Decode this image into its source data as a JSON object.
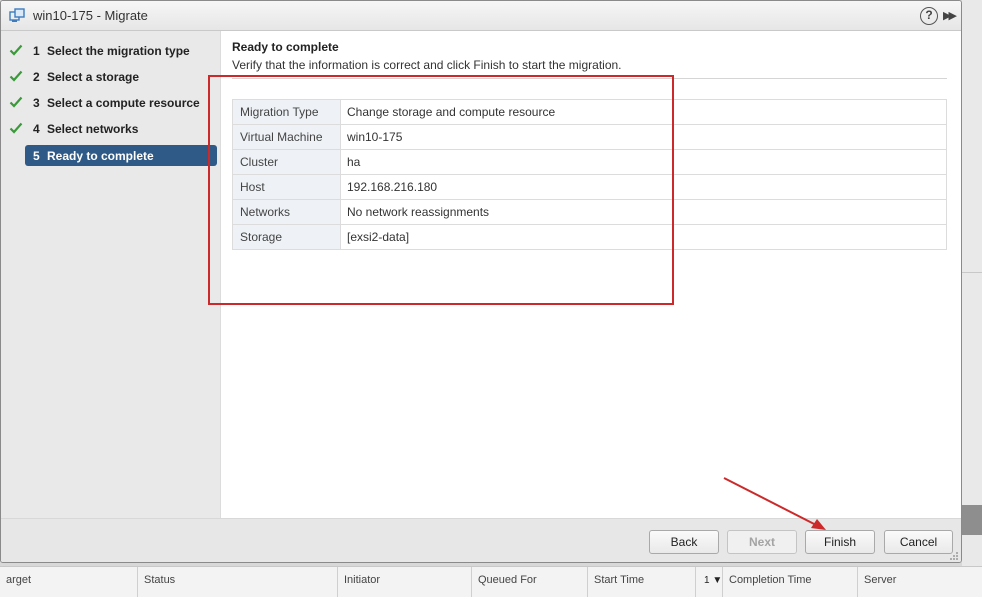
{
  "dialog": {
    "title": "win10-175 - Migrate",
    "help_label": "?",
    "expand_label": "▶▶"
  },
  "steps": [
    {
      "num": "1",
      "label": "Select the migration type",
      "done": true
    },
    {
      "num": "2",
      "label": "Select a storage",
      "done": true
    },
    {
      "num": "3",
      "label": "Select a compute resource",
      "done": true
    },
    {
      "num": "4",
      "label": "Select networks",
      "done": true
    },
    {
      "num": "5",
      "label": "Ready to complete",
      "done": false,
      "active": true
    }
  ],
  "content": {
    "title": "Ready to complete",
    "subtitle": "Verify that the information is correct and click Finish to start the migration.",
    "summary": [
      {
        "key": "Migration Type",
        "value": "Change storage and compute resource"
      },
      {
        "key": "Virtual Machine",
        "value": "win10-175"
      },
      {
        "key": "Cluster",
        "value": "ha"
      },
      {
        "key": "Host",
        "value": "192.168.216.180"
      },
      {
        "key": "Networks",
        "value": "No network reassignments"
      },
      {
        "key": "Storage",
        "value": "[exsi2-data]"
      }
    ]
  },
  "footer": {
    "back_label": "Back",
    "next_label": "Next",
    "finish_label": "Finish",
    "cancel_label": "Cancel"
  },
  "tasks_table": {
    "columns": [
      "arget",
      "Status",
      "Initiator",
      "Queued For",
      "Start Time",
      "Completion Time",
      "Server"
    ],
    "sort_indicator": "1 ▼"
  },
  "colors": {
    "active_step": "#2f5a87",
    "check_green": "#3a9a3a",
    "annotation_red": "#cc2a2a"
  }
}
